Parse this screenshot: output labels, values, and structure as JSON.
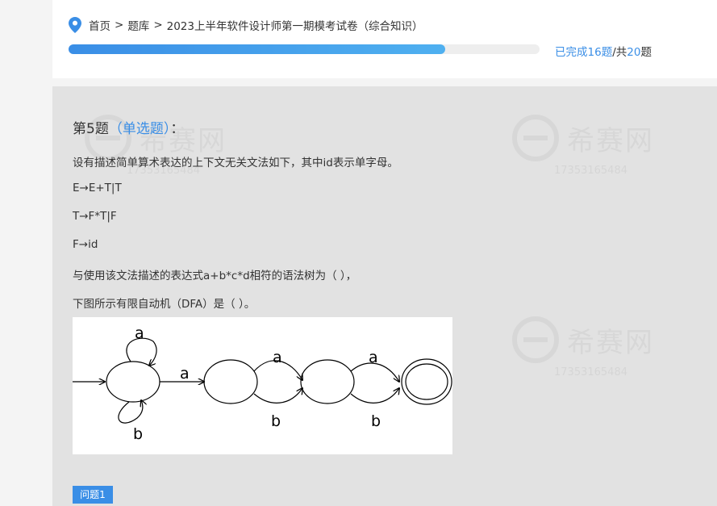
{
  "breadcrumb": {
    "home": "首页",
    "separator": ">",
    "bank": "题库",
    "paper": "2023上半年软件设计师第一期模考试卷（综合知识）"
  },
  "progress": {
    "completed_label": "已完成",
    "completed": "16",
    "question_unit": "题",
    "total_label": "/共",
    "total": "20",
    "fraction": 0.8,
    "fill_color": "#3a8ee6"
  },
  "watermark": {
    "brand": "希赛网",
    "number": "17353165484"
  },
  "question": {
    "number_label": "第5题",
    "type": "（单选题）",
    "colon": "：",
    "lines": [
      "设有描述简单算术表达的上下文无关文法如下，其中id表示单字母。",
      "E→E+T|T",
      "T→F*T|F",
      "F→id",
      "与使用该文法描述的表达式a+b*c*d相符的语法树为（    ），",
      "下图所示有限自动机（DFA）是（    ）。"
    ],
    "figure": {
      "loop_top_label": "a",
      "loop_bottom_label": "b",
      "edge_1_label": "a",
      "edge_2_top_label": "a",
      "edge_2_bottom_label": "b",
      "edge_3_top_label": "a",
      "edge_3_bottom_label": "b"
    }
  },
  "sub_question_tag": "问题1",
  "colors": {
    "accent": "#3a8ee6",
    "content_bg": "#e2e2e2"
  }
}
